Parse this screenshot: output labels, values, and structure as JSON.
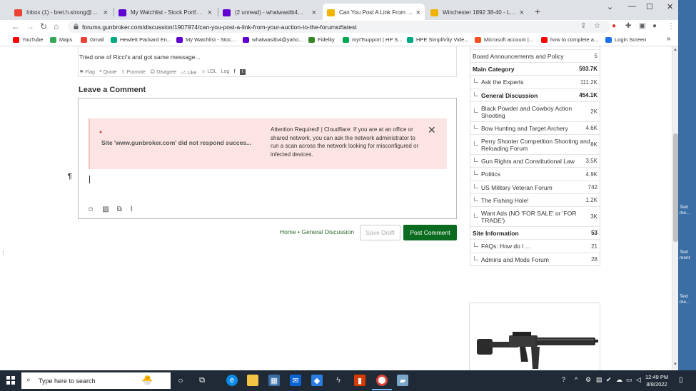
{
  "browser": {
    "tabs": [
      {
        "label": "Inbox (1) - bret.h.strong@gmail.c",
        "icon": "gmail-icon",
        "color": "#ea4335",
        "active": false
      },
      {
        "label": "My Watchlist - Stock Portfolio &",
        "icon": "yahoo-icon",
        "color": "#6001d2",
        "active": false
      },
      {
        "label": "(2 unread) - whatwasitb4@yahoo",
        "icon": "yahoo-mail-icon",
        "color": "#6001d2",
        "active": false
      },
      {
        "label": "Can You Post A Link From Your A",
        "icon": "gunbroker-icon",
        "color": "#f0b400",
        "active": true
      },
      {
        "label": "Winchester 1892 38-40 - Lever A",
        "icon": "gunbroker-icon",
        "color": "#f0b400",
        "active": false
      }
    ],
    "new_tab": "+",
    "window_controls": {
      "minimize": "⌄",
      "restore": "—",
      "maximize": "☐",
      "close": "✕"
    },
    "url": "forums.gunbroker.com/discussion/1907974/can-you-post-a-link-from-your-auction-to-the-forums#latest",
    "bookmarks": [
      {
        "label": "YouTube",
        "color": "#ff0000"
      },
      {
        "label": "Maps",
        "color": "#34a853"
      },
      {
        "label": "Gmail",
        "color": "#ea4335"
      },
      {
        "label": "Hewlett Packard En...",
        "color": "#01a982"
      },
      {
        "label": "My Watchlist - Stoc...",
        "color": "#6001d2"
      },
      {
        "label": "whatwasitb4@yaho...",
        "color": "#6001d2"
      },
      {
        "label": "Fidelity",
        "color": "#368727"
      },
      {
        "label": "myITsupport | HP S...",
        "color": "#00a651"
      },
      {
        "label": "HPE SimpliVity Vide...",
        "color": "#01a982"
      },
      {
        "label": "Microsoft account |...",
        "color": "#f25022"
      },
      {
        "label": "how to complete a...",
        "color": "#ff0000"
      },
      {
        "label": "Login Screen",
        "color": "#1a73e8"
      }
    ],
    "bookmarks_more": "»"
  },
  "page": {
    "previous_comment": "Tried one of Ricci's and got same message...",
    "reactions": [
      "Flag",
      "Quote",
      "Promote",
      "Disagree",
      "Like",
      "LOL",
      "Log"
    ],
    "leave_comment_title": "Leave a Comment",
    "alert": {
      "left_text": "Site 'www.gunbroker.com' did not respond succes...",
      "right_text": "Attention Required! | Cloudflare: If you are at an office or shared network, you can ask the network administrator to run a scan across the network looking for misconfigured or infected devices.",
      "close": "✕"
    },
    "pilcrow": "¶",
    "breadcrumb": {
      "home": "Home",
      "separator": " • ",
      "category": "General Discussion"
    },
    "save_draft": "Save Draft",
    "post_comment": "Post Comment"
  },
  "categories": [
    {
      "name": "Board Announcements and Policy",
      "count": "5",
      "bold": false,
      "sub": false,
      "h": 18
    },
    {
      "name": "Main Category",
      "count": "593.7K",
      "bold": true,
      "sub": false,
      "h": 18
    },
    {
      "name": "Ask the Experts",
      "count": "111.2K",
      "bold": false,
      "sub": true,
      "h": 19
    },
    {
      "name": "General Discussion",
      "count": "454.1K",
      "bold": true,
      "sub": true,
      "h": 18
    },
    {
      "name": "Black Powder and Cowboy Action Shooting",
      "count": "2K",
      "bold": false,
      "sub": true,
      "h": 28
    },
    {
      "name": "Bow Hunting and Target Archery",
      "count": "4.6K",
      "bold": false,
      "sub": true,
      "h": 18
    },
    {
      "name": "Perry Shooter Competition Shooting and Reloading Forum",
      "count": "8K",
      "bold": false,
      "sub": true,
      "h": 28
    },
    {
      "name": "Gun Rights and Constitutional Law",
      "count": "3.5K",
      "bold": false,
      "sub": true,
      "h": 18
    },
    {
      "name": "Politics",
      "count": "4.9K",
      "bold": false,
      "sub": true,
      "h": 19
    },
    {
      "name": "US Military Veteran Forum",
      "count": "742",
      "bold": false,
      "sub": true,
      "h": 18
    },
    {
      "name": "The Fishing Hole!",
      "count": "1.2K",
      "bold": false,
      "sub": true,
      "h": 18
    },
    {
      "name": "Want Ads (NO 'FOR SALE' or 'FOR TRADE')",
      "count": "3K",
      "bold": false,
      "sub": true,
      "h": 28
    },
    {
      "name": "Site Information",
      "count": "53",
      "bold": true,
      "sub": false,
      "h": 18
    },
    {
      "name": "FAQs: How do I ...",
      "count": "21",
      "bold": false,
      "sub": true,
      "h": 19
    },
    {
      "name": "Admins and Mods Forum",
      "count": "28",
      "bold": false,
      "sub": true,
      "h": 18
    }
  ],
  "desktop": {
    "labels": [
      "Text me...",
      "Text ment",
      "Text me..."
    ]
  },
  "taskbar": {
    "search_placeholder": "Type here to search",
    "time": "12:49 PM",
    "date": "8/8/2022"
  }
}
